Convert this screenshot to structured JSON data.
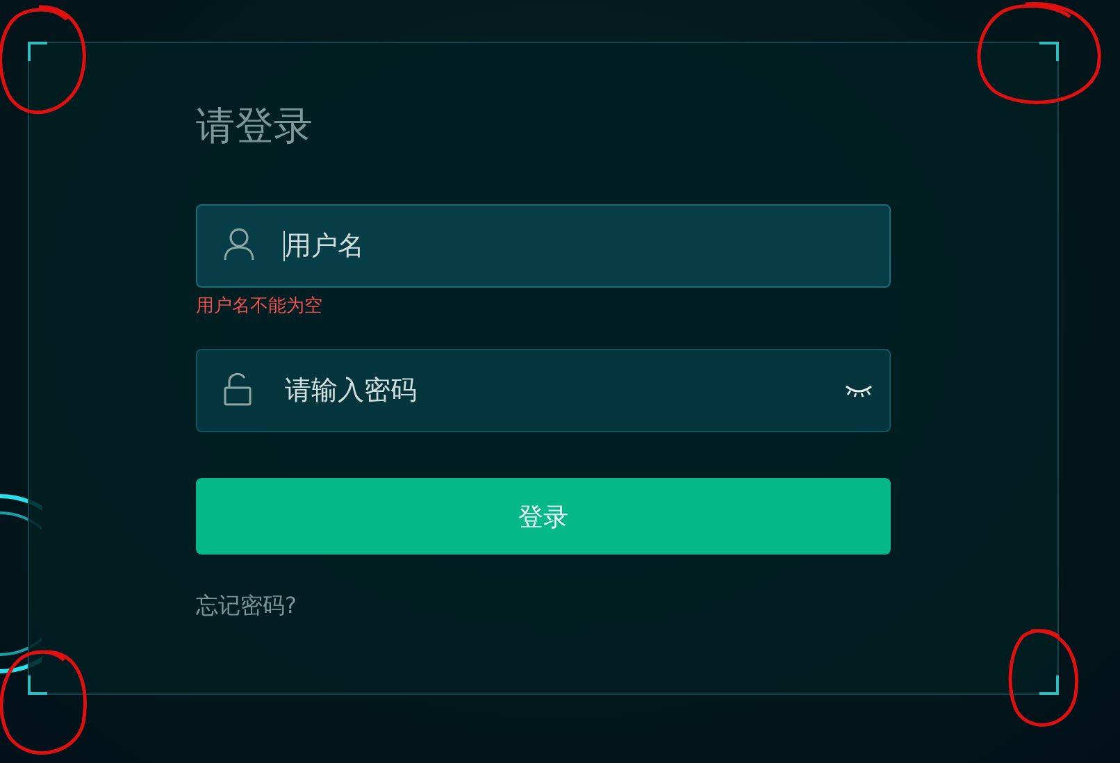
{
  "title": "请登录",
  "fields": [
    {
      "kind": "text",
      "placeholder": "用户名",
      "focused": true,
      "error": "用户名不能为空"
    },
    {
      "kind": "password",
      "placeholder": "请输入密码",
      "focused": false
    }
  ],
  "submit": "登录",
  "forgot_link": "忘记密码?"
}
